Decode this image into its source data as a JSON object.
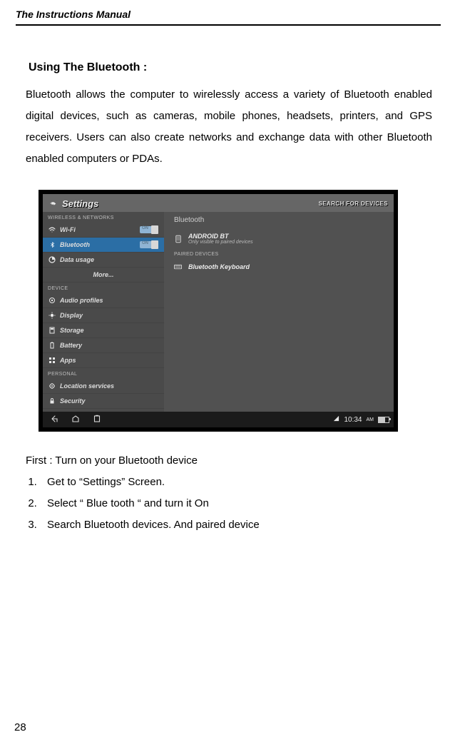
{
  "doc": {
    "manual_title": "The Instructions Manual",
    "page_number": "28"
  },
  "section": {
    "heading": "Using The Bluetooth :",
    "intro": "Bluetooth allows the computer to wirelessly access a variety of Bluetooth enabled digital devices, such as cameras, mobile phones, headsets, printers, and GPS receivers. Users can also create networks and exchange data with other Bluetooth enabled computers or PDAs.",
    "first_line": "First : Turn on your Bluetooth device",
    "steps": [
      "Get to “Settings” Screen.",
      "Select “ Blue tooth “ and turn it On",
      "Search Bluetooth devices. And paired device"
    ]
  },
  "shot": {
    "title": "Settings",
    "search_button": "SEARCH FOR DEVICES",
    "sidebar": {
      "headers": [
        "WIRELESS & NETWORKS",
        "DEVICE",
        "PERSONAL"
      ],
      "items": {
        "wifi": "Wi-Fi",
        "bluetooth": "Bluetooth",
        "data_usage": "Data usage",
        "more": "More...",
        "audio": "Audio profiles",
        "display": "Display",
        "storage": "Storage",
        "battery": "Battery",
        "apps": "Apps",
        "location": "Location services",
        "security": "Security"
      },
      "toggle_state": "ON"
    },
    "main": {
      "title": "Bluetooth",
      "device_name": "ANDROID BT",
      "device_sub": "Only visible to paired devices",
      "paired_header": "PAIRED DEVICES",
      "paired_device": "Bluetooth Keyboard"
    },
    "sysbar": {
      "time": "10:34",
      "ampm": "AM"
    }
  }
}
